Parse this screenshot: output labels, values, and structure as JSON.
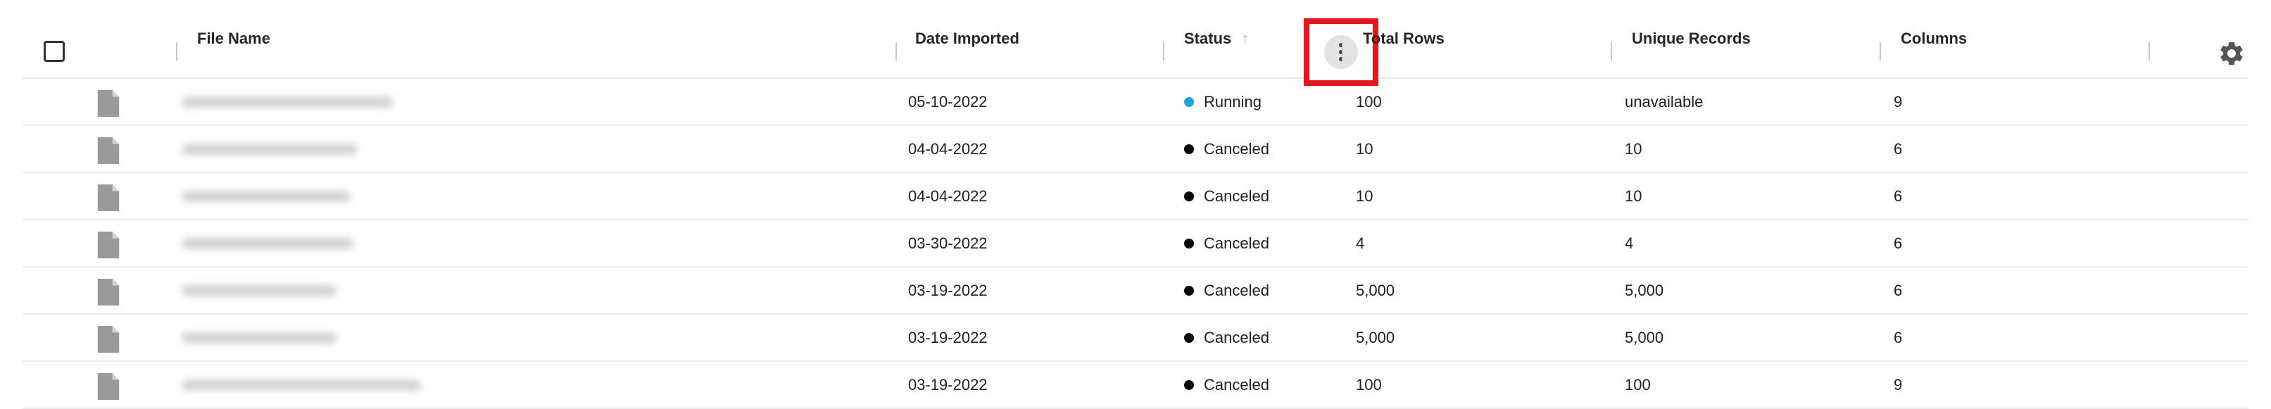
{
  "header": {
    "columns": {
      "file_name": "File Name",
      "date_imported": "Date Imported",
      "status": "Status",
      "total_rows": "Total Rows",
      "unique_records": "Unique Records",
      "columns": "Columns"
    },
    "sort_icon": "↑"
  },
  "icons": {
    "row_icon": "file-icon",
    "settings": "gear-icon",
    "column_menu": "more-vertical-icon",
    "sort": "arrow-up-icon"
  },
  "colors": {
    "running": "#1fa6d9",
    "canceled": "#000000",
    "highlight": "#e8151c"
  },
  "rows": [
    {
      "date": "05-10-2022",
      "status": "Running",
      "status_color": "#1fa6d9",
      "total_rows": "100",
      "unique_records": "unavailable",
      "columns": "9"
    },
    {
      "date": "04-04-2022",
      "status": "Canceled",
      "status_color": "#000000",
      "total_rows": "10",
      "unique_records": "10",
      "columns": "6"
    },
    {
      "date": "04-04-2022",
      "status": "Canceled",
      "status_color": "#000000",
      "total_rows": "10",
      "unique_records": "10",
      "columns": "6"
    },
    {
      "date": "03-30-2022",
      "status": "Canceled",
      "status_color": "#000000",
      "total_rows": "4",
      "unique_records": "4",
      "columns": "6"
    },
    {
      "date": "03-19-2022",
      "status": "Canceled",
      "status_color": "#000000",
      "total_rows": "5,000",
      "unique_records": "5,000",
      "columns": "6"
    },
    {
      "date": "03-19-2022",
      "status": "Canceled",
      "status_color": "#000000",
      "total_rows": "5,000",
      "unique_records": "5,000",
      "columns": "6"
    },
    {
      "date": "03-19-2022",
      "status": "Canceled",
      "status_color": "#000000",
      "total_rows": "100",
      "unique_records": "100",
      "columns": "9"
    }
  ]
}
